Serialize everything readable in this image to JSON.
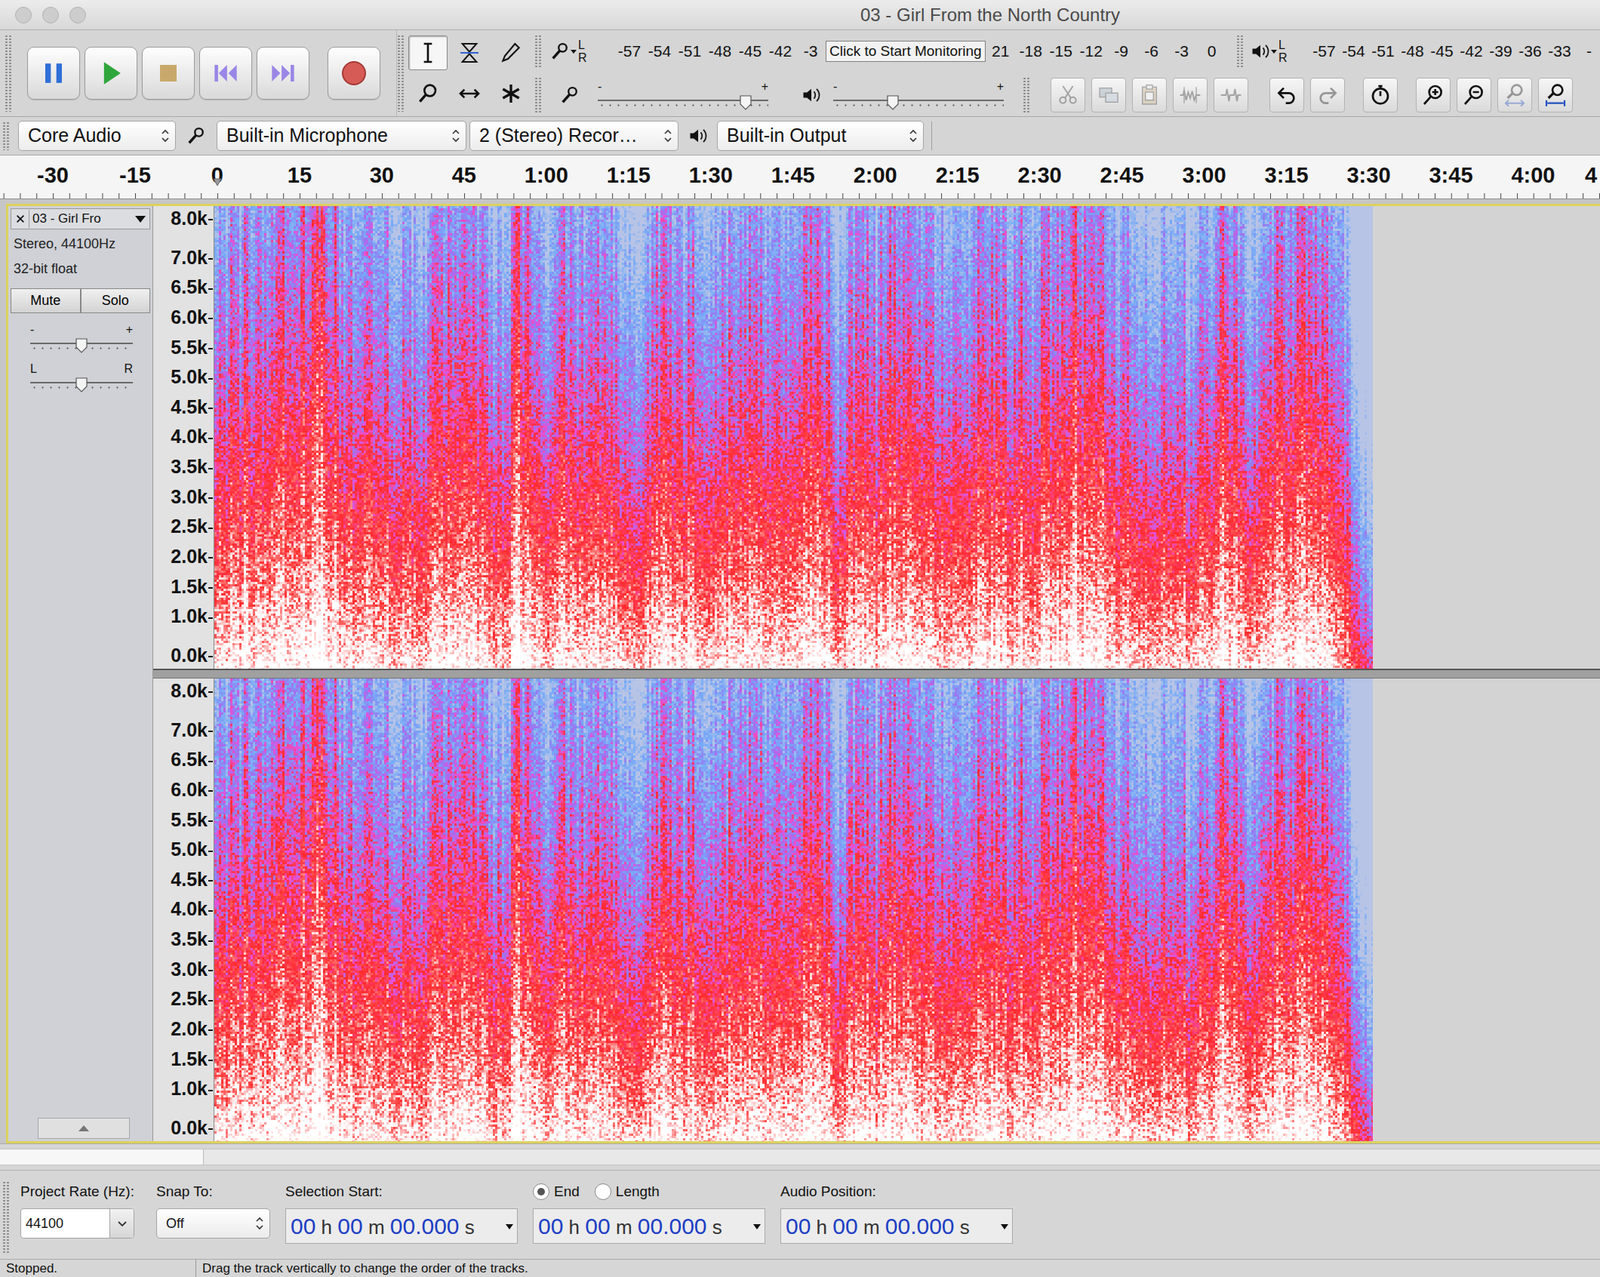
{
  "window": {
    "title": "03 - Girl From the North Country"
  },
  "transport": [
    {
      "kind": "pause"
    },
    {
      "kind": "play"
    },
    {
      "kind": "stop"
    },
    {
      "kind": "skip-start"
    },
    {
      "kind": "skip-end"
    },
    {
      "kind": "record"
    }
  ],
  "tools": [
    {
      "kind": "select",
      "selected": true
    },
    {
      "kind": "envelope",
      "selected": false
    },
    {
      "kind": "draw",
      "selected": false
    },
    {
      "kind": "zoom",
      "selected": false
    },
    {
      "kind": "timeshift",
      "selected": false
    },
    {
      "kind": "multi",
      "selected": false
    }
  ],
  "record_meter": {
    "left": "L",
    "right": "R",
    "ticks_before": [
      "-57",
      "-54",
      "-51",
      "-48",
      "-45",
      "-42",
      "-3"
    ],
    "prompt": "Click to Start Monitoring",
    "ticks_after": [
      "21",
      "-18",
      "-15",
      "-12",
      "-9",
      "-6",
      "-3",
      "0"
    ]
  },
  "play_meter": {
    "left": "L",
    "right": "R",
    "ticks": [
      "-57",
      "-54",
      "-51",
      "-48",
      "-45",
      "-42",
      "-39",
      "-36",
      "-33",
      "-"
    ]
  },
  "record_volume": {
    "minus": "-",
    "plus": "+",
    "level": 0.86
  },
  "play_volume": {
    "minus": "-",
    "plus": "+",
    "level": 0.35
  },
  "edit_tools": [
    {
      "kind": "cut",
      "disabled": true
    },
    {
      "kind": "copy",
      "disabled": true
    },
    {
      "kind": "paste",
      "disabled": true
    },
    {
      "kind": "trim",
      "disabled": true
    },
    {
      "kind": "silence",
      "disabled": true
    },
    {
      "kind": "undo",
      "disabled": false
    },
    {
      "kind": "redo",
      "disabled": true
    },
    {
      "kind": "timer",
      "disabled": false
    },
    {
      "kind": "zoom-in",
      "disabled": false
    },
    {
      "kind": "zoom-out",
      "disabled": false
    },
    {
      "kind": "fit-selection",
      "disabled": true
    },
    {
      "kind": "fit-project",
      "disabled": false
    }
  ],
  "devices": {
    "host": "Core Audio",
    "input": "Built-in Microphone",
    "channels": "2 (Stereo) Recor…",
    "output": "Built-in Output"
  },
  "ruler": [
    "-30",
    "-15",
    "0",
    "15",
    "30",
    "45",
    "1:00",
    "1:15",
    "1:30",
    "1:45",
    "2:00",
    "2:15",
    "2:30",
    "2:45",
    "3:00",
    "3:15",
    "3:30",
    "3:45",
    "4:00",
    "4"
  ],
  "track": {
    "name": "03 - Girl Fro",
    "info": [
      "Stereo, 44100Hz",
      "32-bit float"
    ],
    "mute": {
      "label": "Mute",
      "on": false
    },
    "solo": {
      "label": "Solo",
      "on": false
    },
    "gain": {
      "minus": "-",
      "plus": "+",
      "level": 0.5
    },
    "pan": {
      "left": "L",
      "right": "R",
      "level": 0.5
    }
  },
  "channels": [
    {
      "axis": [
        "8.0k",
        "7.0k",
        "6.5k",
        "6.0k",
        "5.5k",
        "5.0k",
        "4.5k",
        "4.0k",
        "3.5k",
        "3.0k",
        "2.5k",
        "2.0k",
        "1.5k",
        "1.0k",
        "0.0k"
      ]
    },
    {
      "axis": [
        "8.0k",
        "7.0k",
        "6.5k",
        "6.0k",
        "5.5k",
        "5.0k",
        "4.5k",
        "4.0k",
        "3.5k",
        "3.0k",
        "2.5k",
        "2.0k",
        "1.5k",
        "1.0k",
        "0.0k"
      ]
    }
  ],
  "selection_bar": {
    "rate_label": "Project Rate (Hz):",
    "rate": "44100",
    "snap_label": "Snap To:",
    "snap": "Off",
    "start_label": "Selection Start:",
    "start": "00 h 00 m 00.000 s",
    "end_mode": [
      {
        "label": "End",
        "selected": true
      },
      {
        "label": "Length",
        "selected": false
      }
    ],
    "end": "00 h 00 m 00.000 s",
    "position_label": "Audio Position:",
    "position": "00 h 00 m 00.000 s"
  },
  "status_bar": {
    "state": "Stopped.",
    "hint": "Drag the track vertically to change the order of the tracks."
  }
}
